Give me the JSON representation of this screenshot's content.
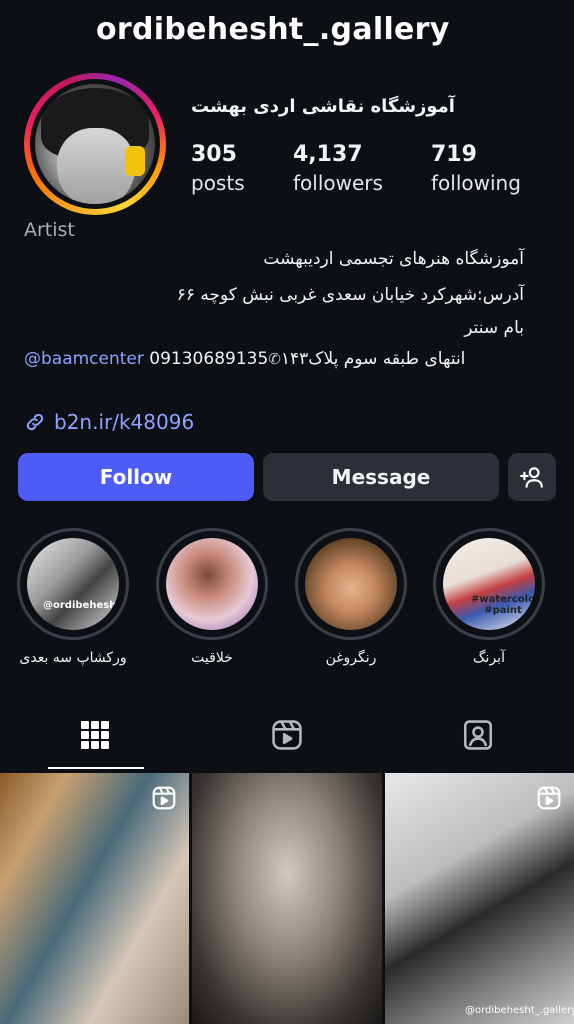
{
  "profile": {
    "username": "ordibehesht_.gallery",
    "display_name": "آموزشگاه نقاشی اردی بهشت",
    "category": "Artist",
    "bio_lines": [
      "آموزشگاه هنرهای تجسمی اردیبهشت",
      "آدرس:شهرکرد خیابان سعدی غربی نبش کوچه ۶۶",
      "بام سنتر"
    ],
    "bio_last_mention": "@baamcenter",
    "bio_last_phone": "09130689135",
    "bio_last_text": "انتهای طبقه سوم پلاک۱۴۳",
    "link": "b2n.ir/k48096"
  },
  "stats": {
    "posts": {
      "value": "305",
      "label": "posts"
    },
    "followers": {
      "value": "4,137",
      "label": "followers"
    },
    "following": {
      "value": "719",
      "label": "following"
    }
  },
  "actions": {
    "follow_label": "Follow",
    "message_label": "Message",
    "add_user_icon": "add-user-icon"
  },
  "highlights": [
    {
      "label": "ورکشاپ سه بعدی",
      "overlay": "@ordibehesht"
    },
    {
      "label": "خلاقیت"
    },
    {
      "label": "رنگروغن"
    },
    {
      "label": "آبرنگ",
      "overlay": "#watercolor #paint"
    }
  ],
  "tabs": [
    {
      "icon": "grid-icon",
      "active": true
    },
    {
      "icon": "reels-icon",
      "active": false
    },
    {
      "icon": "tagged-icon",
      "active": false
    }
  ],
  "posts": [
    {
      "reel": true
    },
    {
      "reel": false
    },
    {
      "reel": true,
      "watermark": "@ordibehesht_.gallery"
    }
  ],
  "colors": {
    "background": "#0c0f14",
    "follow_button": "#4f5bf5",
    "secondary_button": "#2b2f36",
    "link": "#8ea2ff",
    "muted_text": "#a8adb5"
  }
}
